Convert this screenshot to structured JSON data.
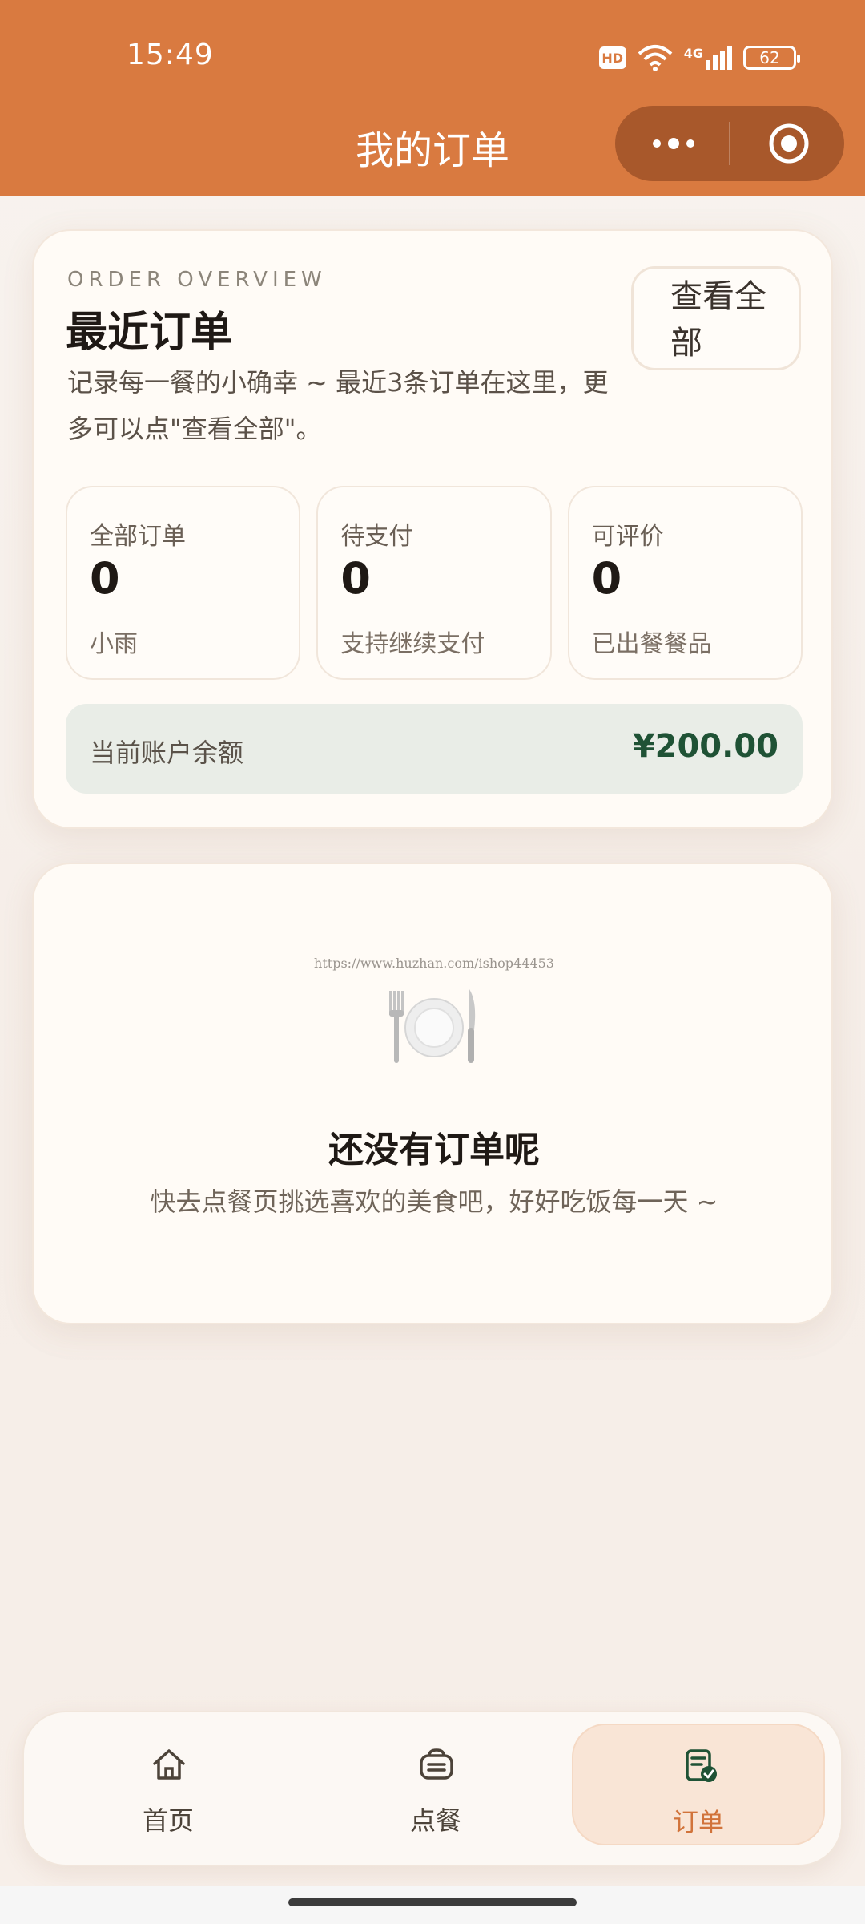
{
  "status_bar": {
    "time": "15:49",
    "hd": "HD",
    "network": "4G",
    "battery": "62"
  },
  "header": {
    "title": "我的订单"
  },
  "overview": {
    "eyebrow": "ORDER OVERVIEW",
    "title": "最近订单",
    "description": "记录每一餐的小确幸 ~ 最近3条订单在这里，更多可以点\"查看全部\"。",
    "view_all": "查看全部",
    "stats": [
      {
        "label": "全部订单",
        "value": "0",
        "sub": "小雨"
      },
      {
        "label": "待支付",
        "value": "0",
        "sub": "支持继续支付"
      },
      {
        "label": "可评价",
        "value": "0",
        "sub": "已出餐餐品"
      }
    ],
    "balance_label": "当前账户余额",
    "balance_value": "¥200.00"
  },
  "empty_state": {
    "watermark": "https://www.huzhan.com/ishop44453",
    "icon": "plate-fork-knife-icon",
    "title": "还没有订单呢",
    "subtitle": "快去点餐页挑选喜欢的美食吧，好好吃饭每一天 ~"
  },
  "tabbar": {
    "items": [
      {
        "label": "首页",
        "icon": "home-icon"
      },
      {
        "label": "点餐",
        "icon": "meal-box-icon"
      },
      {
        "label": "订单",
        "icon": "order-doc-icon",
        "active": true
      }
    ]
  },
  "colors": {
    "accent": "#d97a40",
    "balance_green": "#1f5235",
    "active_tab_bg": "#f9e5d6"
  }
}
